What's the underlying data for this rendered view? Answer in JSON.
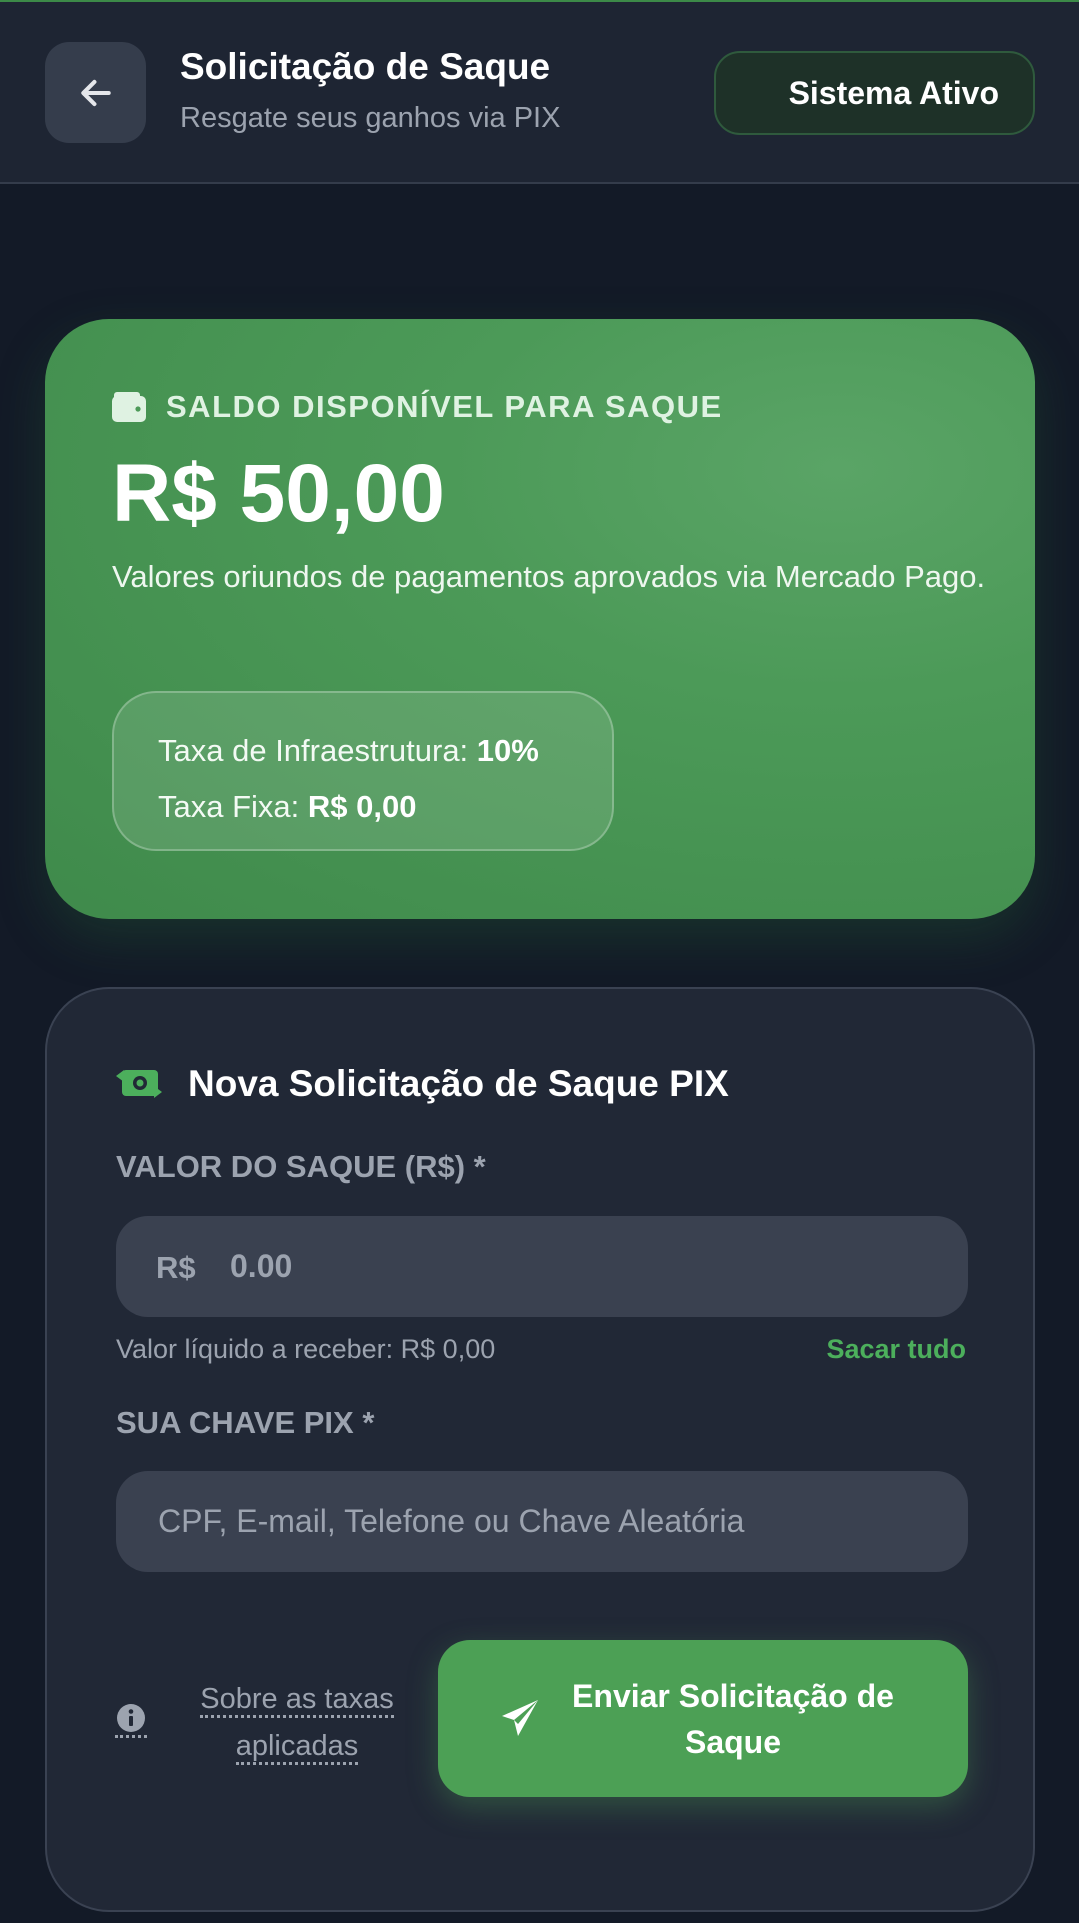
{
  "header": {
    "back_icon": "arrow-left-icon",
    "title": "Solicitação de Saque",
    "subtitle": "Resgate seus ganhos via PIX",
    "status": "Sistema Ativo"
  },
  "balance": {
    "icon": "wallet-icon",
    "label": "SALDO DISPONÍVEL PARA SAQUE",
    "amount": "R$ 50,00",
    "description": "Valores oriundos de pagamentos aprovados via Mercado Pago.",
    "fees": {
      "infra_label": "Taxa de Infraestrutura: ",
      "infra_value": "10%",
      "fixed_label": "Taxa Fixa: ",
      "fixed_value": "R$ 0,00"
    }
  },
  "form": {
    "icon": "money-transfer-icon",
    "title": "Nova Solicitação de Saque PIX",
    "amount_label": "VALOR DO SAQUE (R$) *",
    "currency_prefix": "R$",
    "amount_placeholder": "0.00",
    "amount_value": "",
    "net_value_text": "Valor líquido a receber: R$ 0,00",
    "withdraw_all": "Sacar tudo",
    "pix_label": "SUA CHAVE PIX *",
    "pix_placeholder": "CPF, E-mail, Telefone ou Chave Aleatória",
    "pix_value": "",
    "fees_link": "Sobre as taxas aplicadas",
    "fees_link_line1": "Sobre as taxas",
    "fees_link_line2": "aplicadas",
    "submit_label": "Enviar Solicitação de Saque"
  },
  "colors": {
    "accent_green": "#4ca055",
    "link_green": "#4caf5c",
    "background": "#131a27",
    "card": "#212836"
  }
}
